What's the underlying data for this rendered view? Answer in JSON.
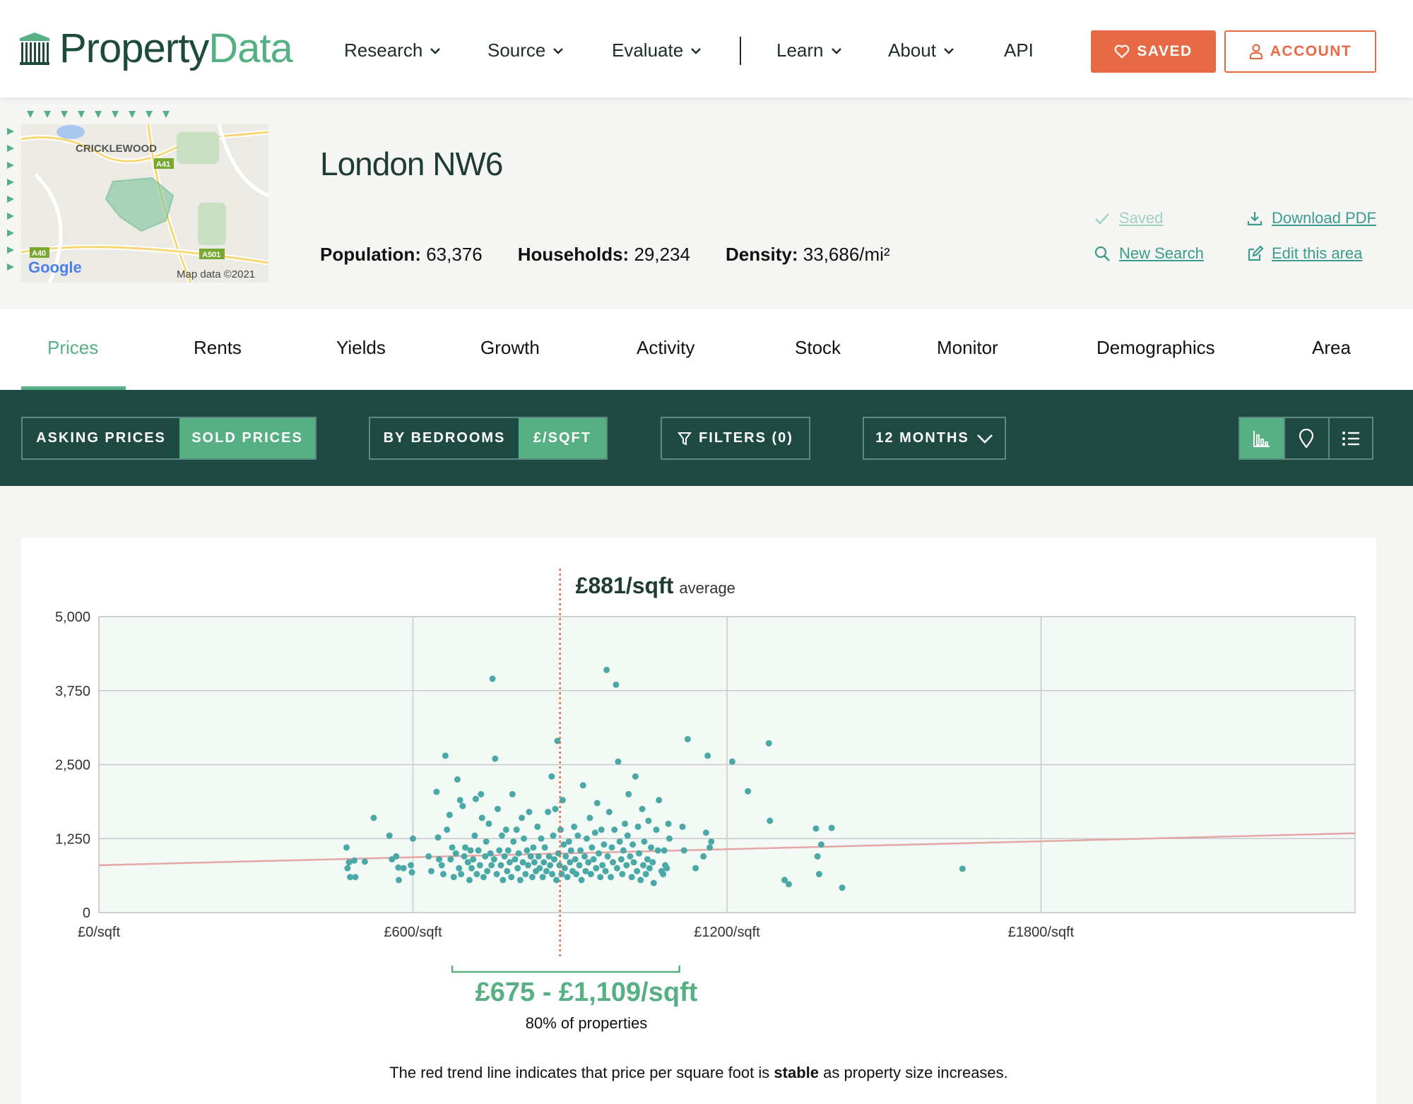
{
  "brand": {
    "name_part1": "Property",
    "name_part2": "Data"
  },
  "nav": {
    "items": [
      {
        "label": "Research",
        "dropdown": true
      },
      {
        "label": "Source",
        "dropdown": true
      },
      {
        "label": "Evaluate",
        "dropdown": true
      },
      {
        "label": "Learn",
        "dropdown": true
      },
      {
        "label": "About",
        "dropdown": true
      },
      {
        "label": "API",
        "dropdown": false
      }
    ],
    "saved_label": "SAVED",
    "account_label": "ACCOUNT"
  },
  "map": {
    "place_label": "CRICKLEWOOD",
    "road_a41": "A41",
    "road_a40": "A40",
    "road_a501": "A501",
    "attribution": "Map data ©2021",
    "google": "Google"
  },
  "area": {
    "title": "London NW6",
    "stats": [
      {
        "label": "Population:",
        "value": "63,376"
      },
      {
        "label": "Households:",
        "value": "29,234"
      },
      {
        "label": "Density:",
        "value": "33,686/mi²"
      }
    ],
    "actions": {
      "saved": "Saved",
      "download_pdf": "Download PDF",
      "new_search": "New Search",
      "edit_area": "Edit this area"
    }
  },
  "tabs": [
    "Prices",
    "Rents",
    "Yields",
    "Growth",
    "Activity",
    "Stock",
    "Monitor",
    "Demographics",
    "Area"
  ],
  "active_tab": "Prices",
  "filters": {
    "asking_prices": "ASKING PRICES",
    "sold_prices": "SOLD PRICES",
    "by_bedrooms": "BY BEDROOMS",
    "per_sqft": "£/SQFT",
    "filters": "FILTERS (0)",
    "period": "12 MONTHS"
  },
  "colors": {
    "brand_green": "#57b083",
    "dark_green": "#1f4a41",
    "orange": "#e86a44",
    "point": "#4aa9a6",
    "trend": "#e5a6a6"
  },
  "chart_data": {
    "type": "scatter",
    "average_value": "£881/sqft",
    "average_suffix": "average",
    "average_x": 881,
    "x_ticks": [
      "£0/sqft",
      "£600/sqft",
      "£1200/sqft",
      "£1800/sqft"
    ],
    "x_tick_values": [
      0,
      600,
      1200,
      1800
    ],
    "y_ticks": [
      "0",
      "1,250",
      "2,500",
      "3,750",
      "5,000"
    ],
    "y_tick_values": [
      0,
      1250,
      2500,
      3750,
      5000
    ],
    "xlim": [
      0,
      2400
    ],
    "ylim": [
      0,
      5000
    ],
    "grid": true,
    "trend": {
      "x": [
        0,
        2400
      ],
      "y": [
        800,
        1340
      ]
    },
    "range_low": 675,
    "range_high": 1109,
    "range_label": "£675 - £1,109/sqft",
    "range_sub": "80% of properties",
    "points": [
      [
        473,
        1100
      ],
      [
        475,
        750
      ],
      [
        478,
        850
      ],
      [
        480,
        600
      ],
      [
        488,
        880
      ],
      [
        490,
        600
      ],
      [
        508,
        860
      ],
      [
        525,
        1600
      ],
      [
        555,
        1300
      ],
      [
        560,
        900
      ],
      [
        568,
        950
      ],
      [
        572,
        760
      ],
      [
        573,
        550
      ],
      [
        582,
        750
      ],
      [
        596,
        800
      ],
      [
        598,
        680
      ],
      [
        600,
        1250
      ],
      [
        630,
        950
      ],
      [
        635,
        700
      ],
      [
        645,
        2040
      ],
      [
        648,
        1270
      ],
      [
        650,
        900
      ],
      [
        655,
        800
      ],
      [
        658,
        650
      ],
      [
        662,
        2650
      ],
      [
        665,
        1400
      ],
      [
        670,
        1650
      ],
      [
        672,
        900
      ],
      [
        675,
        1100
      ],
      [
        678,
        600
      ],
      [
        682,
        1000
      ],
      [
        685,
        2250
      ],
      [
        688,
        750
      ],
      [
        690,
        1900
      ],
      [
        692,
        650
      ],
      [
        695,
        1800
      ],
      [
        698,
        950
      ],
      [
        700,
        1100
      ],
      [
        705,
        850
      ],
      [
        708,
        550
      ],
      [
        710,
        1050
      ],
      [
        712,
        750
      ],
      [
        715,
        900
      ],
      [
        718,
        1300
      ],
      [
        720,
        1920
      ],
      [
        722,
        650
      ],
      [
        725,
        1050
      ],
      [
        728,
        800
      ],
      [
        730,
        2000
      ],
      [
        732,
        1600
      ],
      [
        735,
        600
      ],
      [
        738,
        950
      ],
      [
        740,
        1200
      ],
      [
        742,
        700
      ],
      [
        745,
        1500
      ],
      [
        748,
        1000
      ],
      [
        750,
        800
      ],
      [
        752,
        3950
      ],
      [
        755,
        900
      ],
      [
        757,
        2600
      ],
      [
        760,
        650
      ],
      [
        762,
        1750
      ],
      [
        765,
        1050
      ],
      [
        768,
        800
      ],
      [
        770,
        1300
      ],
      [
        772,
        550
      ],
      [
        775,
        950
      ],
      [
        778,
        1400
      ],
      [
        780,
        700
      ],
      [
        782,
        1050
      ],
      [
        785,
        850
      ],
      [
        788,
        600
      ],
      [
        790,
        2000
      ],
      [
        792,
        1200
      ],
      [
        795,
        900
      ],
      [
        798,
        1400
      ],
      [
        800,
        750
      ],
      [
        802,
        1000
      ],
      [
        805,
        550
      ],
      [
        808,
        1600
      ],
      [
        810,
        850
      ],
      [
        812,
        1250
      ],
      [
        815,
        650
      ],
      [
        818,
        1050
      ],
      [
        820,
        800
      ],
      [
        822,
        1700
      ],
      [
        825,
        950
      ],
      [
        828,
        600
      ],
      [
        830,
        1100
      ],
      [
        832,
        850
      ],
      [
        835,
        700
      ],
      [
        838,
        1450
      ],
      [
        840,
        950
      ],
      [
        842,
        750
      ],
      [
        845,
        1250
      ],
      [
        848,
        600
      ],
      [
        850,
        850
      ],
      [
        852,
        1100
      ],
      [
        855,
        700
      ],
      [
        858,
        1700
      ],
      [
        860,
        950
      ],
      [
        862,
        800
      ],
      [
        865,
        2300
      ],
      [
        866,
        650
      ],
      [
        868,
        1300
      ],
      [
        870,
        900
      ],
      [
        872,
        1750
      ],
      [
        874,
        550
      ],
      [
        876,
        2900
      ],
      [
        878,
        1000
      ],
      [
        880,
        800
      ],
      [
        882,
        1400
      ],
      [
        884,
        650
      ],
      [
        886,
        1900
      ],
      [
        888,
        1150
      ],
      [
        890,
        750
      ],
      [
        892,
        950
      ],
      [
        895,
        600
      ],
      [
        898,
        1200
      ],
      [
        900,
        850
      ],
      [
        902,
        1050
      ],
      [
        905,
        700
      ],
      [
        908,
        1450
      ],
      [
        910,
        900
      ],
      [
        912,
        650
      ],
      [
        915,
        1300
      ],
      [
        918,
        800
      ],
      [
        920,
        1050
      ],
      [
        922,
        550
      ],
      [
        925,
        2150
      ],
      [
        928,
        950
      ],
      [
        930,
        700
      ],
      [
        932,
        1250
      ],
      [
        935,
        850
      ],
      [
        938,
        1600
      ],
      [
        940,
        650
      ],
      [
        942,
        1100
      ],
      [
        945,
        900
      ],
      [
        948,
        1350
      ],
      [
        950,
        750
      ],
      [
        952,
        1850
      ],
      [
        955,
        1000
      ],
      [
        958,
        600
      ],
      [
        960,
        1400
      ],
      [
        962,
        800
      ],
      [
        965,
        1150
      ],
      [
        968,
        700
      ],
      [
        970,
        4100
      ],
      [
        972,
        950
      ],
      [
        975,
        1700
      ],
      [
        978,
        600
      ],
      [
        980,
        1100
      ],
      [
        982,
        850
      ],
      [
        985,
        1400
      ],
      [
        988,
        3850
      ],
      [
        990,
        750
      ],
      [
        992,
        2550
      ],
      [
        995,
        1200
      ],
      [
        998,
        900
      ],
      [
        1000,
        650
      ],
      [
        1002,
        1050
      ],
      [
        1005,
        1500
      ],
      [
        1008,
        800
      ],
      [
        1010,
        1300
      ],
      [
        1012,
        2000
      ],
      [
        1015,
        950
      ],
      [
        1018,
        600
      ],
      [
        1020,
        1150
      ],
      [
        1022,
        850
      ],
      [
        1025,
        2300
      ],
      [
        1028,
        700
      ],
      [
        1030,
        1450
      ],
      [
        1032,
        1000
      ],
      [
        1035,
        550
      ],
      [
        1038,
        1750
      ],
      [
        1040,
        800
      ],
      [
        1042,
        1200
      ],
      [
        1045,
        650
      ],
      [
        1048,
        900
      ],
      [
        1050,
        1550
      ],
      [
        1052,
        750
      ],
      [
        1055,
        1100
      ],
      [
        1058,
        850
      ],
      [
        1060,
        500
      ],
      [
        1065,
        1400
      ],
      [
        1068,
        1050
      ],
      [
        1070,
        1900
      ],
      [
        1075,
        700
      ],
      [
        1078,
        650
      ],
      [
        1080,
        1050
      ],
      [
        1082,
        800
      ],
      [
        1085,
        750
      ],
      [
        1088,
        1500
      ],
      [
        1090,
        1250
      ],
      [
        1115,
        1450
      ],
      [
        1118,
        1050
      ],
      [
        1125,
        2930
      ],
      [
        1140,
        750
      ],
      [
        1155,
        950
      ],
      [
        1160,
        1350
      ],
      [
        1163,
        2650
      ],
      [
        1167,
        1100
      ],
      [
        1170,
        1200
      ],
      [
        1210,
        2550
      ],
      [
        1240,
        2050
      ],
      [
        1280,
        2860
      ],
      [
        1282,
        1550
      ],
      [
        1310,
        550
      ],
      [
        1318,
        480
      ],
      [
        1370,
        1420
      ],
      [
        1373,
        950
      ],
      [
        1376,
        650
      ],
      [
        1380,
        1150
      ],
      [
        1400,
        1430
      ],
      [
        1420,
        420
      ],
      [
        1650,
        740
      ]
    ]
  },
  "note": {
    "before": "The red trend line indicates that price per square foot is ",
    "bold": "stable",
    "after": " as property size increases."
  }
}
